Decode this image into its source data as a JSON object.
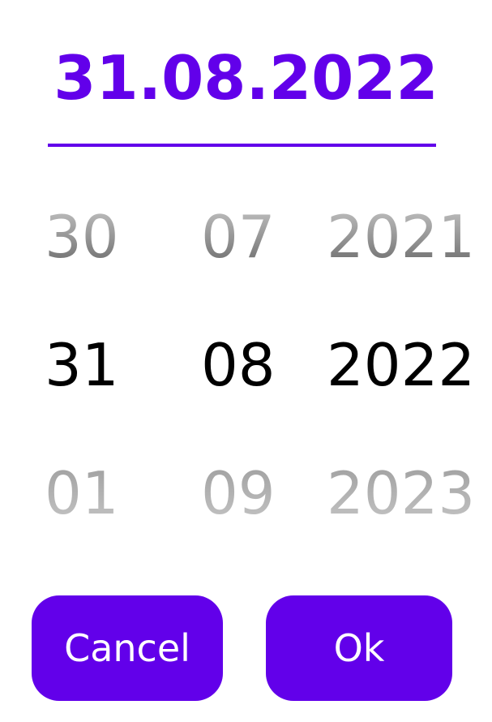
{
  "colors": {
    "accent": "#6200ea"
  },
  "header": {
    "selected_date": "31.08.2022"
  },
  "wheels": {
    "day": {
      "prev": "30",
      "current": "31",
      "next": "01"
    },
    "month": {
      "prev": "07",
      "current": "08",
      "next": "09"
    },
    "year": {
      "prev": "2021",
      "current": "2022",
      "next": "2023"
    }
  },
  "actions": {
    "cancel_label": "Cancel",
    "ok_label": "Ok"
  }
}
